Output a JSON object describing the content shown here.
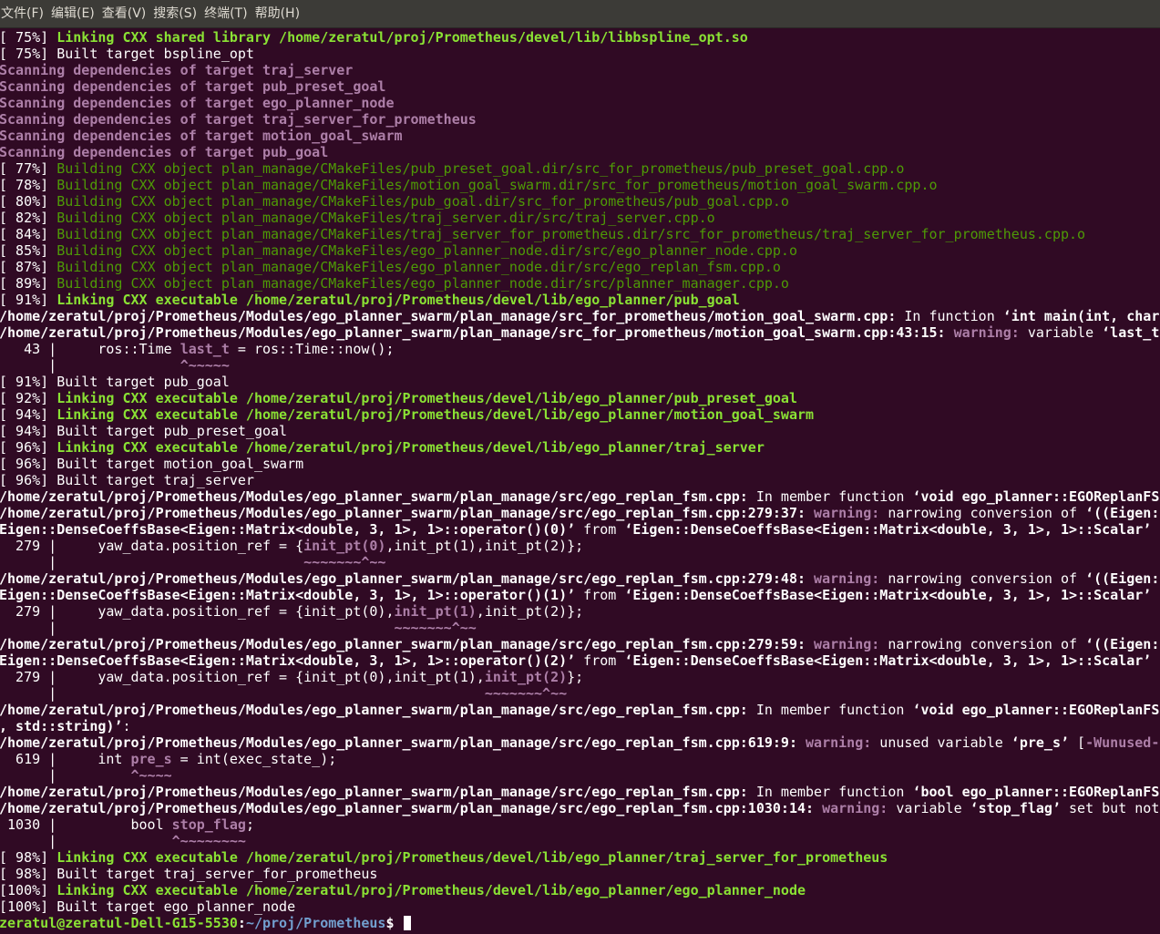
{
  "menubar": {
    "items": [
      "文件(F)",
      "编辑(E)",
      "查看(V)",
      "搜索(S)",
      "终端(T)",
      "帮助(H)"
    ]
  },
  "colors": {
    "background": "#300a24",
    "white": "#ffffff",
    "green": "#8ae234",
    "dark_green": "#4e9a06",
    "magenta": "#ad7fa8",
    "blue": "#729fcf",
    "cursor": "#ffffff"
  },
  "terminal": {
    "lines": [
      [
        [
          "white",
          "[ 75%] "
        ],
        [
          "green",
          "Linking CXX shared library /home/zeratul/proj/Prometheus/devel/lib/libbspline_opt.so",
          1
        ]
      ],
      [
        [
          "white",
          "[ 75%] Built target bspline_opt"
        ]
      ],
      [
        [
          "magenta",
          "Scanning dependencies of target traj_server",
          1
        ]
      ],
      [
        [
          "magenta",
          "Scanning dependencies of target pub_preset_goal",
          1
        ]
      ],
      [
        [
          "magenta",
          "Scanning dependencies of target ego_planner_node",
          1
        ]
      ],
      [
        [
          "magenta",
          "Scanning dependencies of target traj_server_for_prometheus",
          1
        ]
      ],
      [
        [
          "magenta",
          "Scanning dependencies of target motion_goal_swarm",
          1
        ]
      ],
      [
        [
          "magenta",
          "Scanning dependencies of target pub_goal",
          1
        ]
      ],
      [
        [
          "white",
          "[ 77%] "
        ],
        [
          "dark_green",
          "Building CXX object plan_manage/CMakeFiles/pub_preset_goal.dir/src_for_prometheus/pub_preset_goal.cpp.o"
        ]
      ],
      [
        [
          "white",
          "[ 78%] "
        ],
        [
          "dark_green",
          "Building CXX object plan_manage/CMakeFiles/motion_goal_swarm.dir/src_for_prometheus/motion_goal_swarm.cpp.o"
        ]
      ],
      [
        [
          "white",
          "[ 80%] "
        ],
        [
          "dark_green",
          "Building CXX object plan_manage/CMakeFiles/pub_goal.dir/src_for_prometheus/pub_goal.cpp.o"
        ]
      ],
      [
        [
          "white",
          "[ 82%] "
        ],
        [
          "dark_green",
          "Building CXX object plan_manage/CMakeFiles/traj_server.dir/src/traj_server.cpp.o"
        ]
      ],
      [
        [
          "white",
          "[ 84%] "
        ],
        [
          "dark_green",
          "Building CXX object plan_manage/CMakeFiles/traj_server_for_prometheus.dir/src_for_prometheus/traj_server_for_prometheus.cpp.o"
        ]
      ],
      [
        [
          "white",
          "[ 85%] "
        ],
        [
          "dark_green",
          "Building CXX object plan_manage/CMakeFiles/ego_planner_node.dir/src/ego_planner_node.cpp.o"
        ]
      ],
      [
        [
          "white",
          "[ 87%] "
        ],
        [
          "dark_green",
          "Building CXX object plan_manage/CMakeFiles/ego_planner_node.dir/src/ego_replan_fsm.cpp.o"
        ]
      ],
      [
        [
          "white",
          "[ 89%] "
        ],
        [
          "dark_green",
          "Building CXX object plan_manage/CMakeFiles/ego_planner_node.dir/src/planner_manager.cpp.o"
        ]
      ],
      [
        [
          "white",
          "[ 91%] "
        ],
        [
          "green",
          "Linking CXX executable /home/zeratul/proj/Prometheus/devel/lib/ego_planner/pub_goal",
          1
        ]
      ],
      [
        [
          "white",
          "/home/zeratul/proj/Prometheus/Modules/ego_planner_swarm/plan_manage/src_for_prometheus/motion_goal_swarm.cpp:",
          1
        ],
        [
          "white",
          " In function "
        ],
        [
          "white",
          "‘int main(int, char**)’",
          1
        ]
      ],
      [
        [
          "white",
          "/home/zeratul/proj/Prometheus/Modules/ego_planner_swarm/plan_manage/src_for_prometheus/motion_goal_swarm.cpp:43:15:",
          1
        ],
        [
          "magenta",
          " warning:",
          1
        ],
        [
          "white",
          " variable "
        ],
        [
          "white",
          "‘last_t’",
          1
        ]
      ],
      [
        [
          "white",
          "   43 |     ros::Time "
        ],
        [
          "magenta",
          "last_t",
          1
        ],
        [
          "white",
          " = ros::Time::now();"
        ]
      ],
      [
        [
          "white",
          "      |               "
        ],
        [
          "magenta",
          "^~~~~~",
          1
        ]
      ],
      [
        [
          "white",
          "[ 91%] Built target pub_goal"
        ]
      ],
      [
        [
          "white",
          "[ 92%] "
        ],
        [
          "green",
          "Linking CXX executable /home/zeratul/proj/Prometheus/devel/lib/ego_planner/pub_preset_goal",
          1
        ]
      ],
      [
        [
          "white",
          "[ 94%] "
        ],
        [
          "green",
          "Linking CXX executable /home/zeratul/proj/Prometheus/devel/lib/ego_planner/motion_goal_swarm",
          1
        ]
      ],
      [
        [
          "white",
          "[ 94%] Built target pub_preset_goal"
        ]
      ],
      [
        [
          "white",
          "[ 96%] "
        ],
        [
          "green",
          "Linking CXX executable /home/zeratul/proj/Prometheus/devel/lib/ego_planner/traj_server",
          1
        ]
      ],
      [
        [
          "white",
          "[ 96%] Built target motion_goal_swarm"
        ]
      ],
      [
        [
          "white",
          "[ 96%] Built target traj_server"
        ]
      ],
      [
        [
          "white",
          "/home/zeratul/proj/Prometheus/Modules/ego_planner_swarm/plan_manage/src/ego_replan_fsm.cpp:",
          1
        ],
        [
          "white",
          " In member function "
        ],
        [
          "white",
          "‘void ego_planner::EGOReplanFSM",
          1
        ]
      ],
      [
        [
          "white",
          "/home/zeratul/proj/Prometheus/Modules/ego_planner_swarm/plan_manage/src/ego_replan_fsm.cpp:279:37:",
          1
        ],
        [
          "magenta",
          " warning:",
          1
        ],
        [
          "white",
          " narrowing conversion of "
        ],
        [
          "white",
          "‘((Eigen::",
          1
        ]
      ],
      [
        [
          "white",
          "Eigen::DenseCoeffsBase<Eigen::Matrix<double, 3, 1>, 1>::operator()(0)’",
          1
        ],
        [
          "white",
          " from "
        ],
        [
          "white",
          "‘Eigen::DenseCoeffsBase<Eigen::Matrix<double, 3, 1>, 1>::Scalar’",
          1
        ]
      ],
      [
        [
          "white",
          "  279 |     yaw_data.position_ref = {"
        ],
        [
          "magenta",
          "init_pt(0)",
          1
        ],
        [
          "white",
          ",init_pt(1),init_pt(2)};"
        ]
      ],
      [
        [
          "white",
          "      |                              "
        ],
        [
          "magenta",
          "~~~~~~~^~~",
          1
        ]
      ],
      [
        [
          "white",
          "/home/zeratul/proj/Prometheus/Modules/ego_planner_swarm/plan_manage/src/ego_replan_fsm.cpp:279:48:",
          1
        ],
        [
          "magenta",
          " warning:",
          1
        ],
        [
          "white",
          " narrowing conversion of "
        ],
        [
          "white",
          "‘((Eigen::",
          1
        ]
      ],
      [
        [
          "white",
          "Eigen::DenseCoeffsBase<Eigen::Matrix<double, 3, 1>, 1>::operator()(1)’",
          1
        ],
        [
          "white",
          " from "
        ],
        [
          "white",
          "‘Eigen::DenseCoeffsBase<Eigen::Matrix<double, 3, 1>, 1>::Scalar’",
          1
        ]
      ],
      [
        [
          "white",
          "  279 |     yaw_data.position_ref = {init_pt(0),"
        ],
        [
          "magenta",
          "init_pt(1)",
          1
        ],
        [
          "white",
          ",init_pt(2)};"
        ]
      ],
      [
        [
          "white",
          "      |                                         "
        ],
        [
          "magenta",
          "~~~~~~~^~~",
          1
        ]
      ],
      [
        [
          "white",
          "/home/zeratul/proj/Prometheus/Modules/ego_planner_swarm/plan_manage/src/ego_replan_fsm.cpp:279:59:",
          1
        ],
        [
          "magenta",
          " warning:",
          1
        ],
        [
          "white",
          " narrowing conversion of "
        ],
        [
          "white",
          "‘((Eigen::",
          1
        ]
      ],
      [
        [
          "white",
          "Eigen::DenseCoeffsBase<Eigen::Matrix<double, 3, 1>, 1>::operator()(2)’",
          1
        ],
        [
          "white",
          " from "
        ],
        [
          "white",
          "‘Eigen::DenseCoeffsBase<Eigen::Matrix<double, 3, 1>, 1>::Scalar’",
          1
        ]
      ],
      [
        [
          "white",
          "  279 |     yaw_data.position_ref = {init_pt(0),init_pt(1),"
        ],
        [
          "magenta",
          "init_pt(2)",
          1
        ],
        [
          "white",
          "};"
        ]
      ],
      [
        [
          "white",
          "      |                                                    "
        ],
        [
          "magenta",
          "~~~~~~~^~~",
          1
        ]
      ],
      [
        [
          "white",
          "/home/zeratul/proj/Prometheus/Modules/ego_planner_swarm/plan_manage/src/ego_replan_fsm.cpp:",
          1
        ],
        [
          "white",
          " In member function "
        ],
        [
          "white",
          "‘void ego_planner::EGOReplanFSM",
          1
        ]
      ],
      [
        [
          "white",
          ", std::string)’",
          1
        ],
        [
          "white",
          ":"
        ]
      ],
      [
        [
          "white",
          "/home/zeratul/proj/Prometheus/Modules/ego_planner_swarm/plan_manage/src/ego_replan_fsm.cpp:619:9:",
          1
        ],
        [
          "magenta",
          " warning:",
          1
        ],
        [
          "white",
          " unused variable "
        ],
        [
          "white",
          "‘pre_s’",
          1
        ],
        [
          "white",
          " ["
        ],
        [
          "magenta",
          "-Wunused-v",
          1
        ]
      ],
      [
        [
          "white",
          "  619 |     int "
        ],
        [
          "magenta",
          "pre_s",
          1
        ],
        [
          "white",
          " = int(exec_state_);"
        ]
      ],
      [
        [
          "white",
          "      |         "
        ],
        [
          "magenta",
          "^~~~~",
          1
        ]
      ],
      [
        [
          "white",
          "/home/zeratul/proj/Prometheus/Modules/ego_planner_swarm/plan_manage/src/ego_replan_fsm.cpp:",
          1
        ],
        [
          "white",
          " In member function "
        ],
        [
          "white",
          "‘bool ego_planner::EGOReplanFSM",
          1
        ]
      ],
      [
        [
          "white",
          "/home/zeratul/proj/Prometheus/Modules/ego_planner_swarm/plan_manage/src/ego_replan_fsm.cpp:1030:14:",
          1
        ],
        [
          "magenta",
          " warning:",
          1
        ],
        [
          "white",
          " variable "
        ],
        [
          "white",
          "‘stop_flag’",
          1
        ],
        [
          "white",
          " set but not"
        ]
      ],
      [
        [
          "white",
          " 1030 |         bool "
        ],
        [
          "magenta",
          "stop_flag",
          1
        ],
        [
          "white",
          ";"
        ]
      ],
      [
        [
          "white",
          "      |              "
        ],
        [
          "magenta",
          "^~~~~~~~~",
          1
        ]
      ],
      [
        [
          "white",
          "[ 98%] "
        ],
        [
          "green",
          "Linking CXX executable /home/zeratul/proj/Prometheus/devel/lib/ego_planner/traj_server_for_prometheus",
          1
        ]
      ],
      [
        [
          "white",
          "[ 98%] Built target traj_server_for_prometheus"
        ]
      ],
      [
        [
          "white",
          "[100%] "
        ],
        [
          "green",
          "Linking CXX executable /home/zeratul/proj/Prometheus/devel/lib/ego_planner/ego_planner_node",
          1
        ]
      ],
      [
        [
          "white",
          "[100%] Built target ego_planner_node"
        ]
      ],
      [
        [
          "green",
          "zeratul@zeratul-Dell-G15-5530",
          1
        ],
        [
          "white",
          ":",
          1
        ],
        [
          "blue",
          "~/proj/Prometheus",
          1
        ],
        [
          "white",
          "$ ",
          1
        ]
      ]
    ]
  }
}
